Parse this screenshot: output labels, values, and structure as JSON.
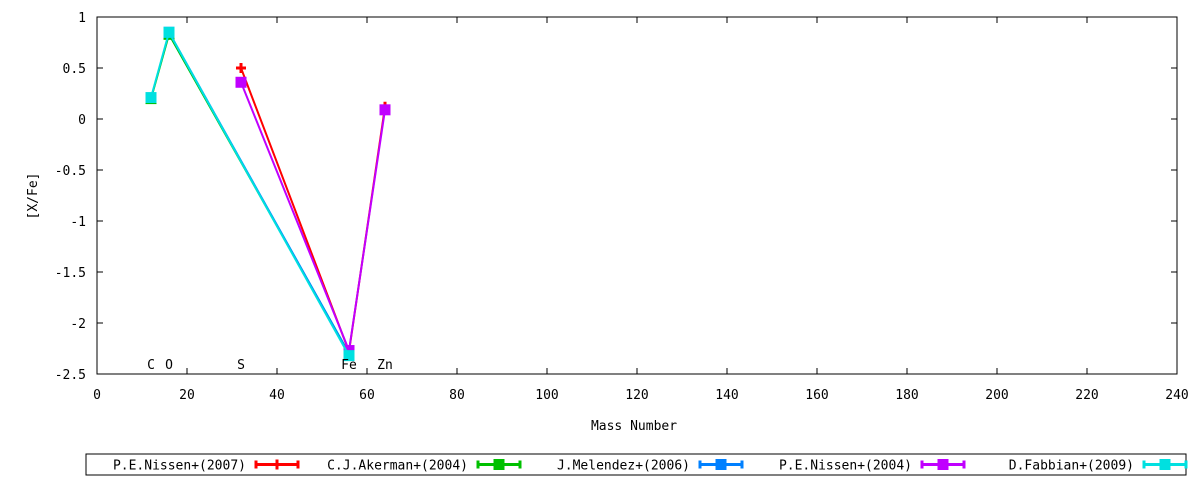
{
  "chart_data": {
    "type": "line",
    "xlabel": "Mass Number",
    "ylabel": "[X/Fe]",
    "xlim": [
      0,
      240
    ],
    "ylim": [
      -2.5,
      1
    ],
    "x_ticks": [
      0,
      20,
      40,
      60,
      80,
      100,
      120,
      140,
      160,
      180,
      200,
      220,
      240
    ],
    "y_ticks": [
      1,
      0.5,
      0,
      -0.5,
      -1,
      -1.5,
      -2,
      -2.5
    ],
    "y_tick_labels": [
      "1",
      "0.5",
      "0",
      "-0.5",
      "-1",
      "-1.5",
      "-2",
      "-2.5"
    ],
    "element_labels": [
      {
        "text": "C",
        "x": 12
      },
      {
        "text": "O",
        "x": 16
      },
      {
        "text": "S",
        "x": 32
      },
      {
        "text": "Fe",
        "x": 56
      },
      {
        "text": "Zn",
        "x": 64
      }
    ],
    "legend_placement": "bottom",
    "series": [
      {
        "name": "P.E.Nissen+(2007)",
        "color": "#ff0000",
        "marker": "plus",
        "points": [
          [
            32,
            0.5
          ],
          [
            56,
            -2.28
          ],
          [
            64,
            0.12
          ]
        ]
      },
      {
        "name": "C.J.Akerman+(2004)",
        "color": "#00c000",
        "marker": "square",
        "points": [
          [
            12,
            0.2
          ],
          [
            16,
            0.83
          ],
          [
            56,
            -2.3
          ]
        ]
      },
      {
        "name": "J.Melendez+(2006)",
        "color": "#0080ff",
        "marker": "square",
        "points": [
          [
            16,
            0.85
          ],
          [
            56,
            -2.3
          ]
        ]
      },
      {
        "name": "P.E.Nissen+(2004)",
        "color": "#c000ff",
        "marker": "square",
        "points": [
          [
            32,
            0.36
          ],
          [
            56,
            -2.27
          ],
          [
            64,
            0.09
          ]
        ]
      },
      {
        "name": "D.Fabbian+(2009)",
        "color": "#00e0e0",
        "marker": "square",
        "points": [
          [
            12,
            0.21
          ],
          [
            16,
            0.85
          ],
          [
            56,
            -2.32
          ]
        ]
      }
    ]
  }
}
